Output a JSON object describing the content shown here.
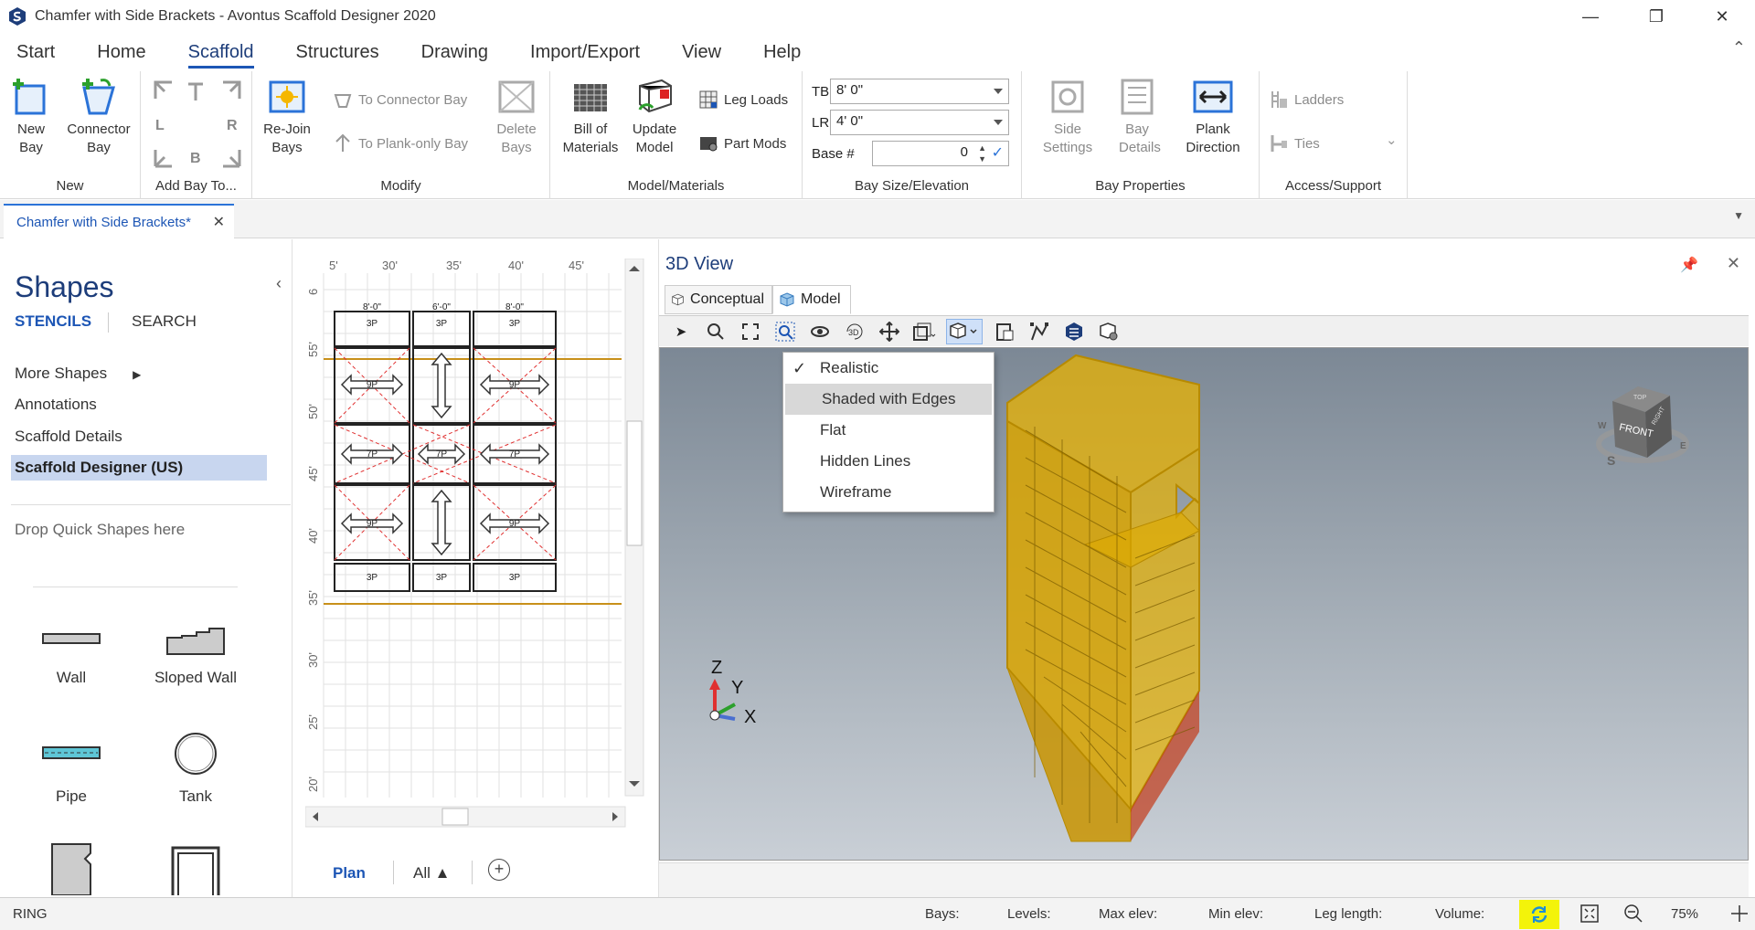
{
  "window": {
    "title": "Chamfer with Side Brackets - Avontus Scaffold Designer 2020",
    "minimize": "—",
    "restore": "❐",
    "close": "✕"
  },
  "menu": {
    "tabs": [
      "Start",
      "Home",
      "Scaffold",
      "Structures",
      "Drawing",
      "Import/Export",
      "View",
      "Help"
    ],
    "active": "Scaffold"
  },
  "ribbon": {
    "new_group": {
      "label": "New",
      "new_bay": "New Bay",
      "connector_bay": "Connector Bay"
    },
    "addbay_group": {
      "label": "Add Bay To...",
      "left": "L",
      "right": "R",
      "bottom": "B"
    },
    "modify_group": {
      "label": "Modify",
      "rejoin": "Re-Join Bays",
      "to_connector": "To Connector Bay",
      "to_plank": "To Plank-only Bay",
      "delete": "Delete Bays"
    },
    "model_group": {
      "label": "Model/Materials",
      "bom": "Bill of Materials",
      "update": "Update Model",
      "leg_loads": "Leg Loads",
      "part_mods": "Part Mods"
    },
    "baysize_group": {
      "label": "Bay Size/Elevation",
      "tb_label": "TB",
      "tb_value": "8' 0\"",
      "lr_label": "LR",
      "lr_value": "4' 0\"",
      "base_label": "Base #",
      "base_value": "0"
    },
    "bayprops_group": {
      "label": "Bay Properties",
      "side_settings": "Side Settings",
      "bay_details": "Bay Details",
      "plank_direction": "Plank Direction"
    },
    "access_group": {
      "label": "Access/Support",
      "ladders": "Ladders",
      "ties": "Ties"
    }
  },
  "doc_tab": {
    "label": "Chamfer with Side Brackets*",
    "close": "✕"
  },
  "shapes_panel": {
    "title": "Shapes",
    "stencils": "STENCILS",
    "search": "SEARCH",
    "collapse": "‹",
    "items": [
      "More Shapes",
      "Annotations",
      "Scaffold Details",
      "Scaffold Designer (US)"
    ],
    "drop_text": "Drop Quick Shapes here",
    "shapes": [
      "Wall",
      "Sloped Wall",
      "Pipe",
      "Tank"
    ]
  },
  "plan": {
    "top_ruler": [
      "5'",
      "30'",
      "35'",
      "40'",
      "45'"
    ],
    "left_ruler": [
      "6",
      "55'",
      "50'",
      "45'",
      "40'",
      "35'",
      "30'",
      "25'",
      "20'"
    ],
    "bay_dims": [
      "8'-0\"",
      "6'-0\"",
      "8'-0\""
    ],
    "plank_labels": [
      "3P",
      "9P",
      "7P",
      "9P"
    ],
    "bottom_tabs": {
      "plan": "Plan",
      "all": "All ▲",
      "add": "+"
    }
  },
  "view3d": {
    "title": "3D View",
    "tabs": [
      "Conceptual",
      "Model"
    ],
    "active_tab": "Model",
    "dropdown": [
      "Realistic",
      "Shaded with Edges",
      "Flat",
      "Hidden Lines",
      "Wireframe"
    ],
    "checked": "Realistic",
    "highlighted": "Shaded with Edges",
    "axes": {
      "z": "Z",
      "y": "Y",
      "x": "X"
    },
    "viewcube": {
      "front": "FRONT",
      "top": "TOP",
      "right": "RIGHT",
      "compass_s": "S",
      "compass_w": "W",
      "compass_e": "E"
    }
  },
  "status": {
    "left": "RING",
    "bays": "Bays:",
    "levels": "Levels:",
    "max_elev": "Max elev:",
    "min_elev": "Min elev:",
    "leg_length": "Leg length:",
    "volume": "Volume:",
    "zoom": "75%"
  },
  "colors": {
    "accent": "#1d56b5",
    "scaffold": "#e8b200",
    "highlight": "#f3f30a"
  }
}
